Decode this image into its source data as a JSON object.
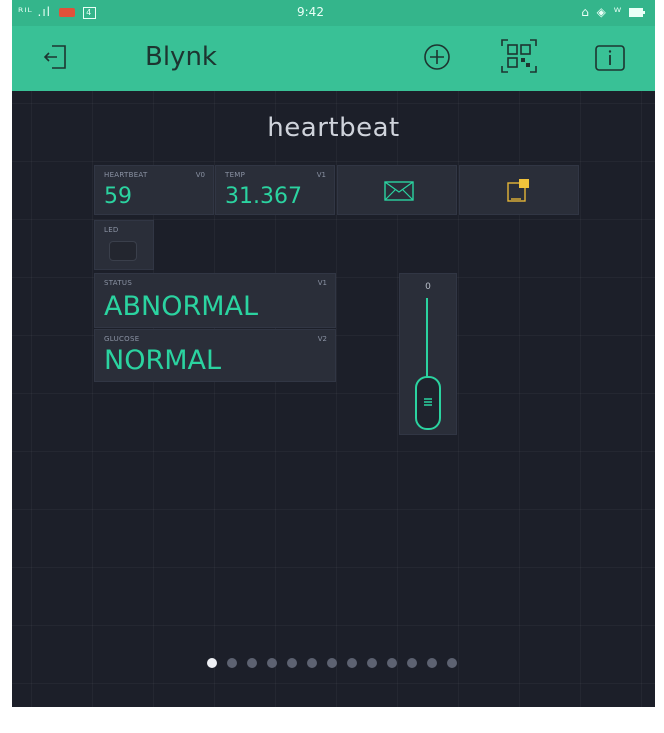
{
  "status_bar": {
    "signal": "ᴿᴵᴸ .ıl",
    "notification_badge": "4",
    "time": "9:42",
    "right_icons": "⌂ ◈ ᵂ"
  },
  "app_bar": {
    "title": "Blynk",
    "icons": [
      "logout-icon",
      "add-icon",
      "qr-code-icon",
      "info-icon"
    ]
  },
  "project": {
    "title": "heartbeat"
  },
  "widgets": {
    "heartbeat": {
      "label": "HEARTBEAT",
      "pin": "V0",
      "value": "59"
    },
    "temp": {
      "label": "TEMP",
      "pin": "V1",
      "value": "31.367"
    },
    "email": {
      "icon": "mail-icon"
    },
    "notification": {
      "icon": "notification-icon"
    },
    "led": {
      "label": "LED"
    },
    "status": {
      "label": "STATUS",
      "pin": "V1",
      "value": "ABNORMAL"
    },
    "glucose": {
      "label": "GLUCOSE",
      "pin": "V2",
      "value": "NORMAL"
    },
    "slider": {
      "value": "0"
    }
  },
  "pagination": {
    "total": 13,
    "active": 0
  },
  "colors": {
    "accent": "#39c196",
    "value_text": "#2bd3a0",
    "background": "#1c1f29",
    "widget_bg": "#2a2e39"
  }
}
